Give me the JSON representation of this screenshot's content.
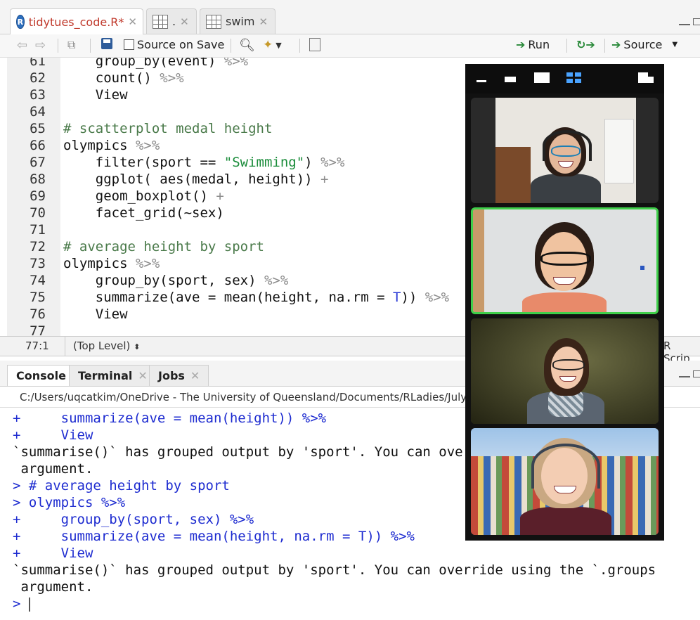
{
  "editor_tabs": [
    {
      "label": "tidytues_code.R*",
      "active": true,
      "modified": true
    },
    {
      "label": ".",
      "active": false
    },
    {
      "label": "swim",
      "active": false
    }
  ],
  "toolbar": {
    "source_on_save": "Source on Save",
    "run": "Run",
    "source": "Source"
  },
  "editor_lines": [
    {
      "n": "61",
      "segs": [
        [
          "    group_by(event) ",
          ""
        ],
        [
          "%>%",
          "op"
        ]
      ]
    },
    {
      "n": "62",
      "segs": [
        [
          "    count() ",
          ""
        ],
        [
          "%>%",
          "op"
        ]
      ]
    },
    {
      "n": "63",
      "segs": [
        [
          "    View",
          ""
        ]
      ]
    },
    {
      "n": "64",
      "segs": [
        [
          "",
          ""
        ]
      ]
    },
    {
      "n": "65",
      "segs": [
        [
          "# scatterplot medal height",
          "cm"
        ]
      ]
    },
    {
      "n": "66",
      "segs": [
        [
          "olympics ",
          ""
        ],
        [
          "%>%",
          "op"
        ]
      ]
    },
    {
      "n": "67",
      "segs": [
        [
          "    filter(sport == ",
          ""
        ],
        [
          "\"Swimming\"",
          "str"
        ],
        [
          ") ",
          ""
        ],
        [
          "%>%",
          "op"
        ]
      ]
    },
    {
      "n": "68",
      "segs": [
        [
          "    ggplot( aes(medal, height)) ",
          ""
        ],
        [
          "+",
          "op"
        ]
      ]
    },
    {
      "n": "69",
      "segs": [
        [
          "    geom_boxplot() ",
          ""
        ],
        [
          "+",
          "op"
        ]
      ]
    },
    {
      "n": "70",
      "segs": [
        [
          "    facet_grid(~sex)",
          ""
        ]
      ]
    },
    {
      "n": "71",
      "segs": [
        [
          "",
          ""
        ]
      ]
    },
    {
      "n": "72",
      "segs": [
        [
          "# average height by sport",
          "cm"
        ]
      ]
    },
    {
      "n": "73",
      "segs": [
        [
          "olympics ",
          ""
        ],
        [
          "%>%",
          "op"
        ]
      ]
    },
    {
      "n": "74",
      "segs": [
        [
          "    group_by(sport, sex) ",
          ""
        ],
        [
          "%>%",
          "op"
        ]
      ]
    },
    {
      "n": "75",
      "segs": [
        [
          "    summarize(ave = mean(height, na.rm = ",
          ""
        ],
        [
          "T",
          "kw"
        ],
        [
          ")) ",
          ""
        ],
        [
          "%>%",
          "op"
        ]
      ]
    },
    {
      "n": "76",
      "segs": [
        [
          "    View",
          ""
        ]
      ]
    },
    {
      "n": "77",
      "segs": [
        [
          "",
          ""
        ]
      ]
    }
  ],
  "status": {
    "position": "77:1",
    "scope": "(Top Level)",
    "filetype": "R Scrip"
  },
  "console_tabs": [
    {
      "label": "Console",
      "active": true,
      "closable": false
    },
    {
      "label": "Terminal",
      "active": false,
      "closable": true
    },
    {
      "label": "Jobs",
      "active": false,
      "closable": true
    }
  ],
  "console_path": "C:/Users/uqcatkim/OneDrive - The University of Queensland/Documents/RLadies/July/",
  "console_lines": [
    {
      "text": "+     summarize(ave = mean(height)) %>%",
      "color": "blue"
    },
    {
      "text": "+     View",
      "color": "blue"
    },
    {
      "text": "`summarise()` has grouped output by 'sport'. You can override using the `.groups",
      "color": "black"
    },
    {
      "text": " argument.",
      "color": "black"
    },
    {
      "text": "> # average height by sport",
      "color": "blue"
    },
    {
      "text": "> olympics %>%",
      "color": "blue"
    },
    {
      "text": "+     group_by(sport, sex) %>%",
      "color": "blue"
    },
    {
      "text": "+     summarize(ave = mean(height, na.rm = T)) %>%",
      "color": "blue"
    },
    {
      "text": "+     View",
      "color": "blue"
    },
    {
      "text": "`summarise()` has grouped output by 'sport'. You can override using the `.groups",
      "color": "black"
    },
    {
      "text": " argument.",
      "color": "black"
    },
    {
      "text": ">",
      "color": "blue",
      "cursor": true
    }
  ],
  "video_participants": [
    {
      "speaking": false
    },
    {
      "speaking": true
    },
    {
      "speaking": false
    },
    {
      "speaking": false
    }
  ],
  "colors": {
    "speaking_border": "#3fcf4a",
    "console_input": "#1d2bd0",
    "comment": "#4a7a4a",
    "string": "#1a8c3a",
    "modified_tab": "#c0392b"
  }
}
